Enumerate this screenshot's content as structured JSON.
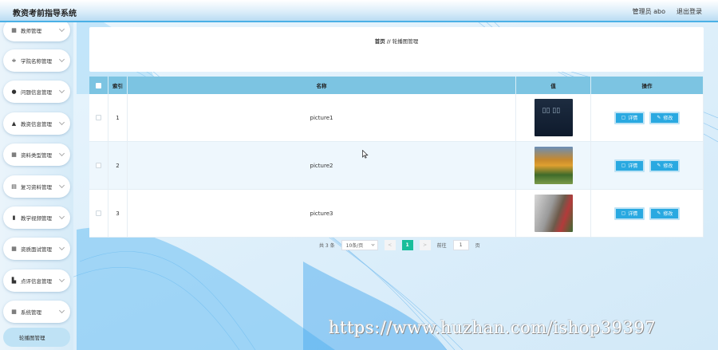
{
  "header": {
    "title": "教资考前指导系统",
    "user": "管理员 abo",
    "logout": "退出登录"
  },
  "sidebar": {
    "items": [
      {
        "label": "教师管理",
        "icon": "grid-icon"
      },
      {
        "label": "学院名称管理",
        "icon": "sliders-icon"
      },
      {
        "label": "问题信息管理",
        "icon": "user-icon"
      },
      {
        "label": "教资信息管理",
        "icon": "user-icon"
      },
      {
        "label": "资料类型管理",
        "icon": "grid-icon"
      },
      {
        "label": "复习资料管理",
        "icon": "list-icon"
      },
      {
        "label": "教学视频管理",
        "icon": "bar-chart-icon"
      },
      {
        "label": "资质面试管理",
        "icon": "grid-icon"
      },
      {
        "label": "点评信息管理",
        "icon": "chart-icon"
      },
      {
        "label": "系统管理",
        "icon": "apps-icon"
      }
    ],
    "sub_item": "轮播图管理"
  },
  "breadcrumb": {
    "home": "首页",
    "sep": "//",
    "current": "轮播图管理"
  },
  "table": {
    "headers": {
      "index": "索引",
      "name": "名称",
      "value": "值",
      "ops": "操作"
    },
    "rows": [
      {
        "index": "1",
        "name": "picture1",
        "thumb": "dark-blue-poster"
      },
      {
        "index": "2",
        "name": "picture2",
        "thumb": "autumn-park"
      },
      {
        "index": "3",
        "name": "picture3",
        "thumb": "building-flowers"
      }
    ],
    "detail_label": "详情",
    "edit_label": "修改"
  },
  "pagination": {
    "total": "共 3 条",
    "page_size": "10条/页",
    "prev": "<",
    "current": "1",
    "next": ">",
    "goto": "前往",
    "goto_value": "1",
    "page_unit": "页"
  },
  "watermark": "https://www.huzhan.com/ishop39397",
  "colors": {
    "header_accent": "#4ab0e6",
    "table_header": "#7cc4e2",
    "button": "#29a9e1",
    "page_active": "#19be9b"
  }
}
